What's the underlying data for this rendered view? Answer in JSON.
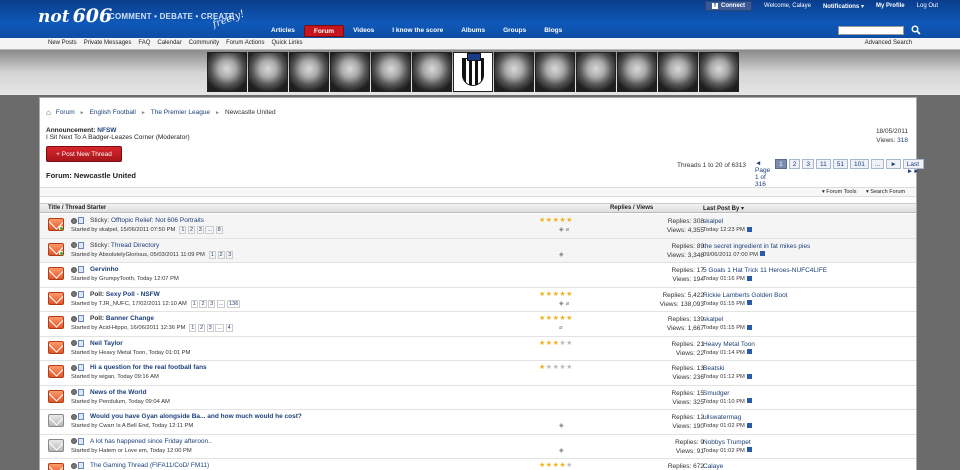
{
  "header": {
    "logo_not": "not",
    "logo_num": "606",
    "tagline": "COMMENT • DEBATE • CREATE",
    "tagline_script": "freely!",
    "connect": "Connect",
    "connect_fb": "f",
    "welcome": "Welcome, Calaye",
    "notifications": "Notifications ▾",
    "my_profile": "My Profile",
    "logout": "Log Out",
    "nav": [
      "Articles",
      "Forum",
      "Videos",
      "I know the score",
      "Albums",
      "Groups",
      "Blogs"
    ],
    "active_nav": "Forum"
  },
  "subnav": {
    "links": [
      "New Posts",
      "Private Messages",
      "FAQ",
      "Calendar",
      "Community",
      "Forum Actions",
      "Quick Links"
    ],
    "advanced_search": "Advanced Search"
  },
  "breadcrumb": [
    "Forum",
    "English Football",
    "The Premier League",
    "Newcastle United"
  ],
  "announcement": {
    "label": "Announcement:",
    "title": "NFSW",
    "subtitle": "I Sit Next To A Badger-Leazes Corner (Moderator)",
    "date": "18/05/2011",
    "views_label": "Views:",
    "views": "318"
  },
  "post_button": "+ Post New Thread",
  "pagination": {
    "summary": "Threads 1 to 20 of 6313",
    "page_of": "◄ Page 1 of 316",
    "pages": [
      "1",
      "2",
      "3",
      "11",
      "51",
      "101",
      "...",
      "►",
      "Last ►►"
    ]
  },
  "forum_title": "Forum: Newcastle United",
  "toolbar": {
    "forum_tools": "▾ Forum Tools",
    "search_forum": "▾ Search Forum"
  },
  "columns": {
    "title": "Title / Thread Starter",
    "replies": "Replies / Views",
    "last_post": "Last Post By ▾"
  },
  "threads": [
    {
      "prefix": "Sticky:",
      "title": "Offtopic Relief: Not 606 Portraits",
      "bold": false,
      "starter": "Started by skalpel, 15/06/2011 07:50 PM",
      "pages": [
        "1",
        "2",
        "3",
        "...",
        "8"
      ],
      "rating": 5,
      "replies": "Replies: 308",
      "views": "Views: 4,355",
      "last_user": "skalpel",
      "last_time": "Today 12:23 PM",
      "state": "new",
      "sticky": true
    },
    {
      "prefix": "Sticky:",
      "title": "Thread Directory",
      "bold": false,
      "starter": "Started by AbsolutelyGlorious, 05/03/2011 11:09 PM",
      "pages": [
        "1",
        "2",
        "3"
      ],
      "rating": 0,
      "replies": "Replies: 89",
      "views": "Views: 3,348",
      "last_user": "the secret ingredient in fat mikes pies",
      "last_time": "09/06/2011 07:00 PM",
      "state": "new",
      "sticky": true
    },
    {
      "prefix": "",
      "title": "Gervinho",
      "bold": true,
      "starter": "Started by GrumpyTooth, Today 12:07 PM",
      "pages": [],
      "rating": 0,
      "replies": "Replies: 17",
      "views": "Views: 194",
      "last_user": "5 Goals 1 Hat Trick 11 Heroes-NUFC4LIFE",
      "last_time": "Today 01:16 PM",
      "state": "new",
      "sticky": false
    },
    {
      "prefix": "Poll:",
      "title": "Sexy Poll - NSFW",
      "bold": true,
      "starter": "Started by TJR_NUFC, 17/02/2011 12:10 AM",
      "pages": [
        "1",
        "2",
        "3",
        "...",
        "136"
      ],
      "rating": 5,
      "replies": "Replies: 5,422",
      "views": "Views: 138,093",
      "last_user": "Rickie Lamberts Golden Boot",
      "last_time": "Today 01:15 PM",
      "state": "new",
      "sticky": false
    },
    {
      "prefix": "Poll:",
      "title": "Banner Change",
      "bold": true,
      "starter": "Started by Acid-Hippo, 16/06/2011 12:36 PM",
      "pages": [
        "1",
        "2",
        "3",
        "...",
        "4"
      ],
      "rating": 5,
      "replies": "Replies: 139",
      "views": "Views: 1,667",
      "last_user": "skalpel",
      "last_time": "Today 01:15 PM",
      "state": "new",
      "sticky": false
    },
    {
      "prefix": "",
      "title": "Neil Taylor",
      "bold": true,
      "starter": "Started by Heavy Metal Toon, Today 01:01 PM",
      "pages": [],
      "rating": 3,
      "replies": "Replies: 21",
      "views": "Views: 22",
      "last_user": "Heavy Metal Toon",
      "last_time": "Today 01:14 PM",
      "state": "new",
      "sticky": false
    },
    {
      "prefix": "",
      "title": "Hi a question for the real football fans",
      "bold": true,
      "starter": "Started by wigan, Today 09:16 AM",
      "pages": [],
      "rating": 1,
      "replies": "Replies: 13",
      "views": "Views: 236",
      "last_user": "Beatski",
      "last_time": "Today 01:12 PM",
      "state": "new",
      "sticky": false
    },
    {
      "prefix": "",
      "title": "News of the World",
      "bold": true,
      "starter": "Started by Pendulum, Today 09:04 AM",
      "pages": [],
      "rating": 0,
      "replies": "Replies: 15",
      "views": "Views: 325",
      "last_user": "Smudger",
      "last_time": "Today 01:10 PM",
      "state": "new",
      "sticky": false
    },
    {
      "prefix": "",
      "title": "Would you have Gyan alongside Ba... and how much would he cost?",
      "bold": true,
      "starter": "Started by Cwarr Is A Bell End, Today 12:11 PM",
      "pages": [],
      "rating": 0,
      "replies": "Replies: 12",
      "views": "Views: 190",
      "last_user": "ullswatermag",
      "last_time": "Today 01:02 PM",
      "state": "read",
      "sticky": false
    },
    {
      "prefix": "",
      "title": "A lot has happened since Friday afteroon..",
      "bold": false,
      "starter": "Started by Hatem or Love em, Today 12:00 PM",
      "pages": [],
      "rating": 0,
      "replies": "Replies: 9",
      "views": "Views: 91",
      "last_user": "Nobbys Trumpet",
      "last_time": "Today 01:02 PM",
      "state": "read",
      "sticky": false
    },
    {
      "prefix": "",
      "title": "The Gaming Thread (FIFA11/CoD/ FM11)",
      "bold": false,
      "starter": "",
      "pages": [],
      "rating": 4,
      "replies": "Replies: 672",
      "views": "",
      "last_user": "Calaye",
      "last_time": "",
      "state": "new",
      "sticky": false
    }
  ]
}
